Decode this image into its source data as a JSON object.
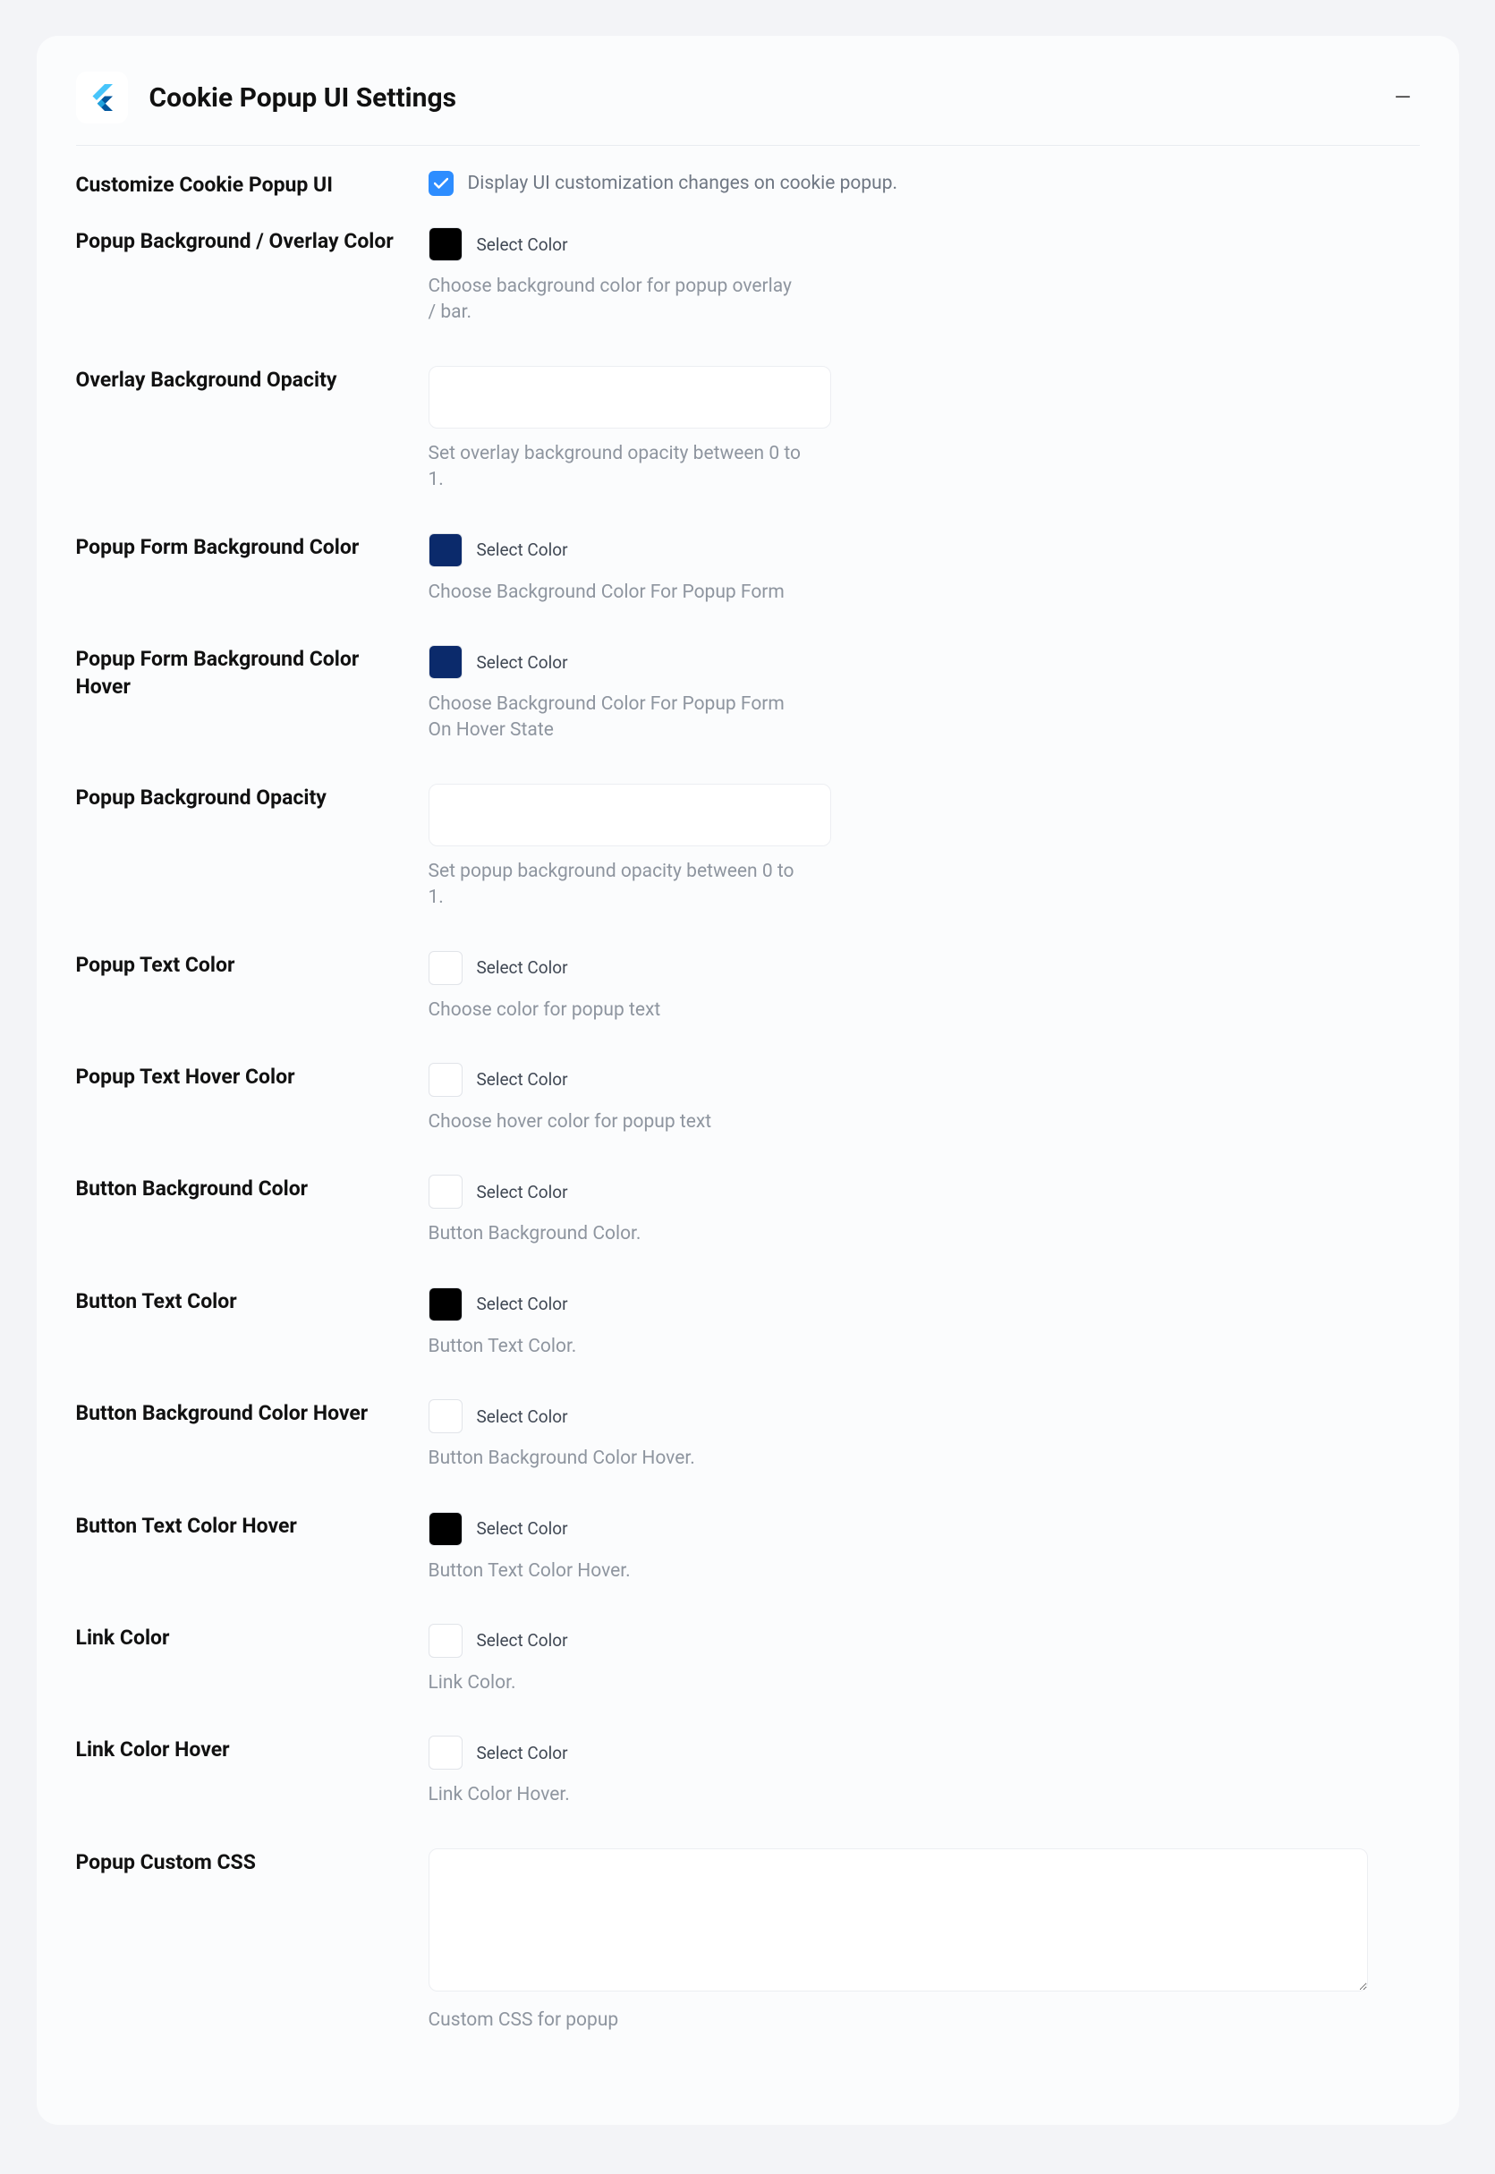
{
  "header": {
    "title": "Cookie Popup UI Settings"
  },
  "customize": {
    "label": "Customize Cookie Popup UI",
    "checkbox_label": "Display UI customization changes on cookie popup.",
    "checked": true
  },
  "fields": {
    "popup_bg": {
      "label": "Popup Background / Overlay Color",
      "select": "Select Color",
      "hint": "Choose background color for popup overlay / bar.",
      "swatch": "#000000"
    },
    "overlay_opacity": {
      "label": "Overlay Background Opacity",
      "value": "",
      "hint": "Set overlay background opacity between 0 to 1."
    },
    "form_bg": {
      "label": "Popup Form Background Color",
      "select": "Select Color",
      "hint": "Choose Background Color For Popup Form",
      "swatch": "#0b2a6b"
    },
    "form_bg_hover": {
      "label": "Popup Form Background Color Hover",
      "select": "Select Color",
      "hint": "Choose Background Color For Popup Form On Hover State",
      "swatch": "#0b2a6b"
    },
    "popup_opacity": {
      "label": "Popup Background Opacity",
      "value": "",
      "hint": "Set popup background opacity between 0 to 1."
    },
    "text_color": {
      "label": "Popup Text Color",
      "select": "Select Color",
      "hint": "Choose color for popup text",
      "swatch": "#ffffff"
    },
    "text_hover": {
      "label": "Popup Text Hover Color",
      "select": "Select Color",
      "hint": "Choose hover color for popup text",
      "swatch": "#ffffff"
    },
    "btn_bg": {
      "label": "Button Background Color",
      "select": "Select Color",
      "hint": "Button Background Color.",
      "swatch": "#ffffff"
    },
    "btn_text": {
      "label": "Button Text Color",
      "select": "Select Color",
      "hint": "Button Text Color.",
      "swatch": "#000000"
    },
    "btn_bg_hover": {
      "label": "Button Background Color Hover",
      "select": "Select Color",
      "hint": "Button Background Color Hover.",
      "swatch": "#ffffff"
    },
    "btn_text_hover": {
      "label": "Button Text Color Hover",
      "select": "Select Color",
      "hint": "Button Text Color Hover.",
      "swatch": "#000000"
    },
    "link_color": {
      "label": "Link Color",
      "select": "Select Color",
      "hint": "Link Color.",
      "swatch": "#ffffff"
    },
    "link_hover": {
      "label": "Link Color Hover",
      "select": "Select Color",
      "hint": "Link Color Hover.",
      "swatch": "#ffffff"
    },
    "custom_css": {
      "label": "Popup Custom CSS",
      "value": "",
      "hint": "Custom CSS for popup"
    }
  }
}
